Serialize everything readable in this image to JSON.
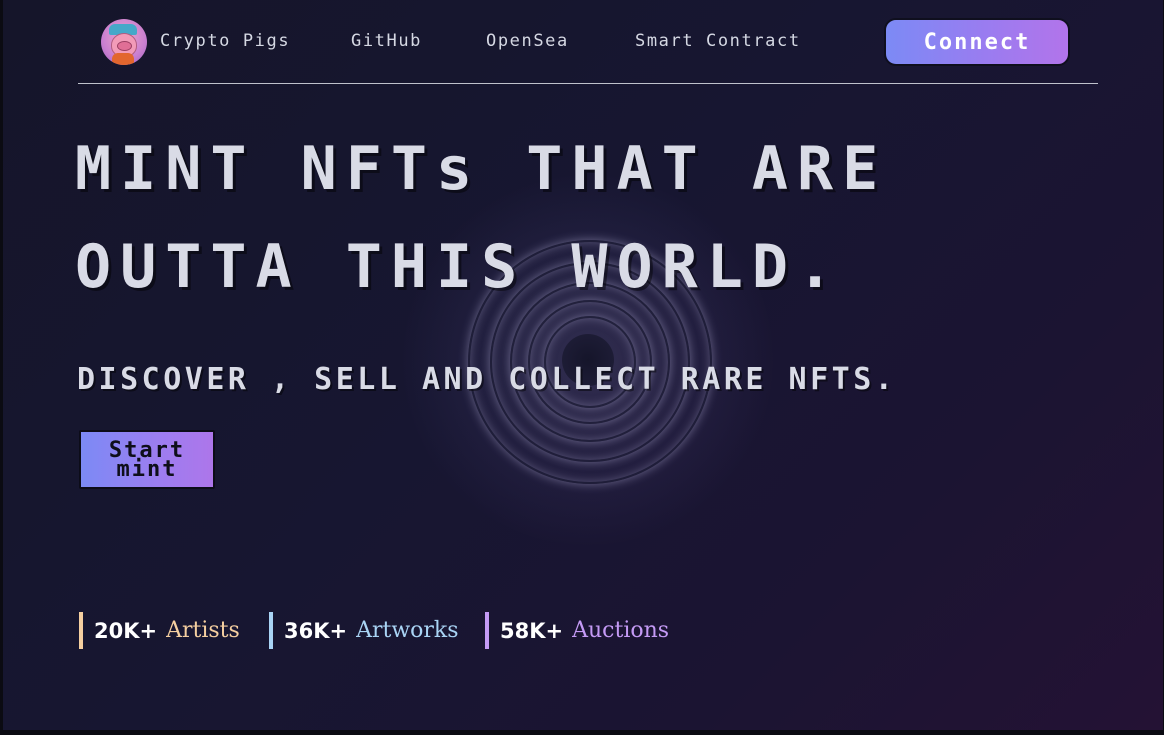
{
  "nav": {
    "brand": "Crypto Pigs",
    "links": [
      "GitHub",
      "OpenSea",
      "Smart Contract"
    ],
    "connect_label": "Connect"
  },
  "hero": {
    "headline_line1": "MINT NFTs THAT ARE",
    "headline_line2": "OUTTA THIS WORLD.",
    "subline": "DISCOVER , SELL AND COLLECT RARE NFTS.",
    "cta_label": "Start mint"
  },
  "stats": [
    {
      "value": "20K+",
      "label": "Artists",
      "color": "#f5cfa0"
    },
    {
      "value": "36K+",
      "label": "Artworks",
      "color": "#a9d4f5"
    },
    {
      "value": "58K+",
      "label": "Auctions",
      "color": "#c49af5"
    }
  ],
  "colors": {
    "background": "#16152d",
    "button_gradient_start": "#7c8af5",
    "button_gradient_end": "#b274ea",
    "text": "#d9dbe6"
  },
  "icons": {
    "logo": "pig-avatar-logo"
  }
}
